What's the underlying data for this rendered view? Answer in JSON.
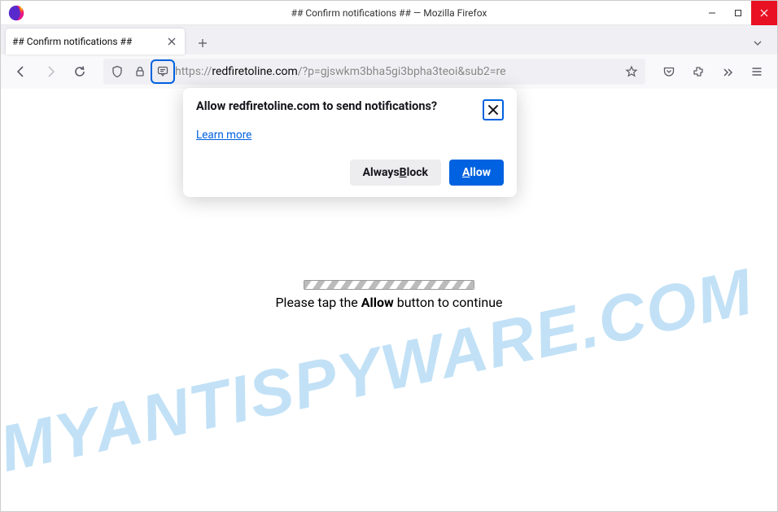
{
  "window": {
    "title": "## Confirm notifications ## — Mozilla Firefox"
  },
  "tab": {
    "label": "## Confirm notifications ##"
  },
  "url": {
    "scheme": "https://",
    "host": "redfiretoline.com",
    "path": "/?p=gjswkm3bha5gi3bpha3teoi&sub2=re"
  },
  "notification": {
    "title": "Allow redfiretoline.com to send notifications?",
    "learn_more": "Learn more",
    "block_prefix": "Always ",
    "block_u": "B",
    "block_rest": "lock",
    "allow_u": "A",
    "allow_rest": "llow"
  },
  "page": {
    "msg_before": "Please tap the ",
    "msg_bold": "Allow",
    "msg_after": " button to continue"
  },
  "watermark": "MYANTISPYWARE.COM"
}
